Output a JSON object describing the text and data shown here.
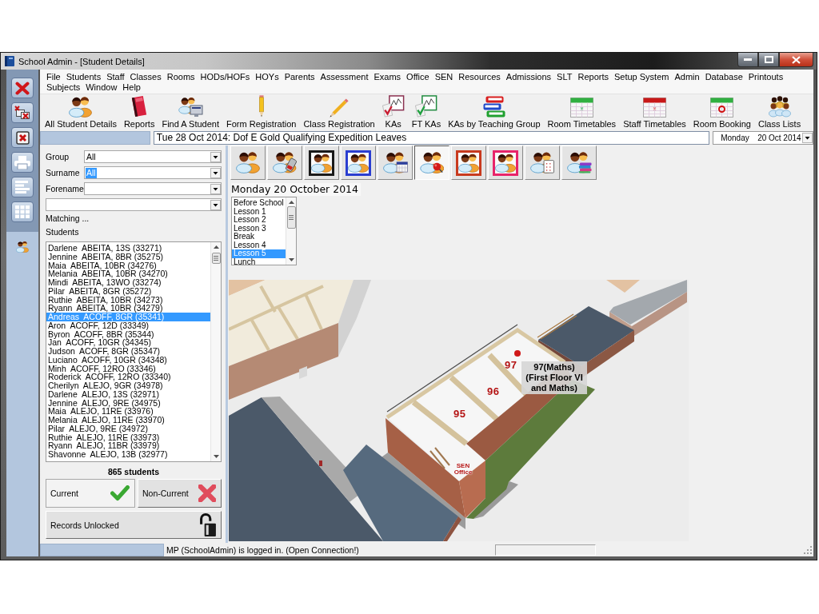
{
  "window": {
    "title": "School Admin - [Student Details]"
  },
  "menu": [
    "File",
    "Students",
    "Staff",
    "Classes",
    "Rooms",
    "HODs/HOFs",
    "HOYs",
    "Parents",
    "Assessment",
    "Exams",
    "Office",
    "SEN",
    "Resources",
    "Admissions",
    "SLT",
    "Reports",
    "Setup System",
    "Admin",
    "Database",
    "Printouts",
    "Subjects",
    "Window",
    "Help"
  ],
  "toolbar": [
    {
      "label": "All Student Details",
      "kind": "people"
    },
    {
      "label": "Reports",
      "kind": "book"
    },
    {
      "label": "Find A Student",
      "kind": "finder"
    },
    {
      "label": "Form Registration",
      "kind": "pencil"
    },
    {
      "label": "Class Registration",
      "kind": "pen"
    },
    {
      "label": "KAs",
      "kind": "chart"
    },
    {
      "label": "FT KAs",
      "kind": "checkchart"
    },
    {
      "label": "KAs by Teaching Group",
      "kind": "books"
    },
    {
      "label": "Room Timetables",
      "kind": "calendar"
    },
    {
      "label": "Staff Timetables",
      "kind": "staffcalendar"
    },
    {
      "label": "Room Booking",
      "kind": "booking"
    },
    {
      "label": "Class Lists",
      "kind": "group"
    }
  ],
  "notice": "Tue 28 Oct 2014: Dof E Gold Qualifying Expedition Leaves",
  "date_picker": {
    "day": "Monday",
    "date": "20 Oct 2014"
  },
  "filters": [
    {
      "label": "Group",
      "value": "All",
      "focused": false
    },
    {
      "label": "Surname",
      "value": "All",
      "focused": true
    },
    {
      "label": "Forename",
      "focused": false
    },
    {
      "focused": false
    }
  ],
  "matching_label": "Matching ...",
  "students": {
    "heading": "Students",
    "items": [
      {
        "text": "Darlene  ABEITA, 13S (33271)",
        "selected": false
      },
      {
        "text": "Jennine  ABEITA, 8BR (35275)",
        "selected": false
      },
      {
        "text": "Maia  ABEITA, 10BR (34276)",
        "selected": false
      },
      {
        "text": "Melania  ABEITA, 10BR (34270)",
        "selected": false
      },
      {
        "text": "Mindi  ABEITA, 13WO (33274)",
        "selected": false
      },
      {
        "text": "Pilar  ABEITA, 8GR (35272)",
        "selected": false
      },
      {
        "text": "Ruthie  ABEITA, 10BR (34273)",
        "selected": false
      },
      {
        "text": "Ryann  ABEITA, 10BR (34279)",
        "selected": false
      },
      {
        "text": "Andreas  ACOFF, 8GR (35341)",
        "selected": true
      },
      {
        "text": "Aron  ACOFF, 12D (33349)",
        "selected": false
      },
      {
        "text": "Byron  ACOFF, 8BR (35344)",
        "selected": false
      },
      {
        "text": "Jan  ACOFF, 10GR (34345)",
        "selected": false
      },
      {
        "text": "Judson  ACOFF, 8GR (35347)",
        "selected": false
      },
      {
        "text": "Luciano  ACOFF, 10GR (34348)",
        "selected": false
      },
      {
        "text": "Minh  ACOFF, 12RO (33346)",
        "selected": false
      },
      {
        "text": "Roderick  ACOFF, 12RO (33340)",
        "selected": false
      },
      {
        "text": "Cherilyn  ALEJO, 9GR (34978)",
        "selected": false
      },
      {
        "text": "Darlene  ALEJO, 13S (32971)",
        "selected": false
      },
      {
        "text": "Jennine  ALEJO, 9RE (34975)",
        "selected": false
      },
      {
        "text": "Maia  ALEJO, 11RE (33976)",
        "selected": false
      },
      {
        "text": "Melania  ALEJO, 11RE (33970)",
        "selected": false
      },
      {
        "text": "Pilar  ALEJO, 9RE (34972)",
        "selected": false
      },
      {
        "text": "Ruthie  ALEJO, 11RE (33973)",
        "selected": false
      },
      {
        "text": "Ryann  ALEJO, 11BR (33979)",
        "selected": false
      },
      {
        "text": "Shavonne  ALEJO, 13B (32977)",
        "selected": false
      }
    ],
    "count": "865 students"
  },
  "record_filters": [
    {
      "label": "Current",
      "kind": "check",
      "selected": true
    },
    {
      "label": "Non-Current",
      "kind": "cross",
      "selected": false
    }
  ],
  "records_button": {
    "label": "Records Unlocked",
    "locked": false
  },
  "views": [
    {
      "kind": "people",
      "selected": false
    },
    {
      "kind": "phone",
      "selected": false
    },
    {
      "kind": "frame",
      "color": "#1a1a1a",
      "selected": false
    },
    {
      "kind": "frame",
      "color": "#2a3ed0",
      "selected": false
    },
    {
      "kind": "calendar",
      "selected": false
    },
    {
      "kind": "pin",
      "selected": true
    },
    {
      "kind": "frame",
      "color": "#c83a1e",
      "selected": false
    },
    {
      "kind": "frame",
      "color": "#e8246a",
      "selected": false
    },
    {
      "kind": "clipboard",
      "selected": false
    },
    {
      "kind": "books",
      "selected": false
    }
  ],
  "day_heading": "Monday 20 October 2014",
  "periods": [
    {
      "label": "Before School",
      "selected": false
    },
    {
      "label": "Lesson 1",
      "selected": false
    },
    {
      "label": "Lesson 2",
      "selected": false
    },
    {
      "label": "Lesson 3",
      "selected": false
    },
    {
      "label": "Break",
      "selected": false
    },
    {
      "label": "Lesson 4",
      "selected": false
    },
    {
      "label": "Lesson 5",
      "selected": true
    },
    {
      "label": "Lunch",
      "selected": false
    }
  ],
  "floor_plan": {
    "room_labels": [
      {
        "text": "97",
        "kind": "room"
      },
      {
        "text": "96",
        "kind": "room"
      },
      {
        "text": "95",
        "kind": "room"
      },
      {
        "text": "SEN\nOffice",
        "kind": "office"
      }
    ],
    "tooltip": "97(Maths)\n(First Floor VI\nand Maths)"
  },
  "status_bar": {
    "message": "MP (SchoolAdmin) is logged in. (Open Connection!)"
  }
}
